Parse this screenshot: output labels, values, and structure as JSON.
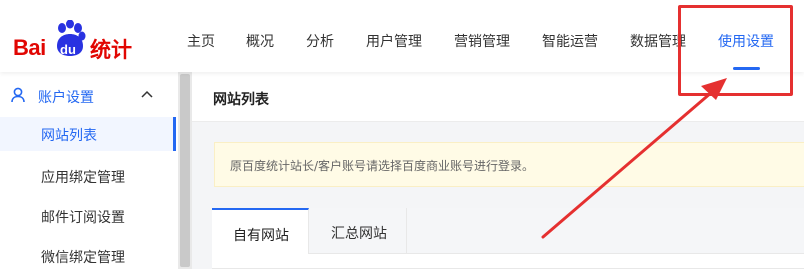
{
  "logo": {
    "brand": "Bai",
    "du": "du",
    "product": "统计"
  },
  "nav": {
    "items": [
      {
        "label": "主页"
      },
      {
        "label": "概况"
      },
      {
        "label": "分析"
      },
      {
        "label": "用户管理"
      },
      {
        "label": "营销管理"
      },
      {
        "label": "智能运营"
      },
      {
        "label": "数据管理"
      },
      {
        "label": "使用设置",
        "active": true
      }
    ]
  },
  "sidebar": {
    "group": {
      "label": "账户设置",
      "expanded": true
    },
    "items": [
      {
        "label": "网站列表",
        "active": true
      },
      {
        "label": "应用绑定管理"
      },
      {
        "label": "邮件订阅设置"
      },
      {
        "label": "微信绑定管理"
      }
    ]
  },
  "main": {
    "title": "网站列表",
    "notice": "原百度统计站长/客户账号请选择百度商业账号进行登录。",
    "tabs": [
      {
        "label": "自有网站",
        "active": true
      },
      {
        "label": "汇总网站"
      }
    ]
  },
  "colors": {
    "accent": "#2468f2",
    "brand": "#e10602",
    "annotation": "#e53030",
    "notice_bg": "#fffbe6"
  }
}
